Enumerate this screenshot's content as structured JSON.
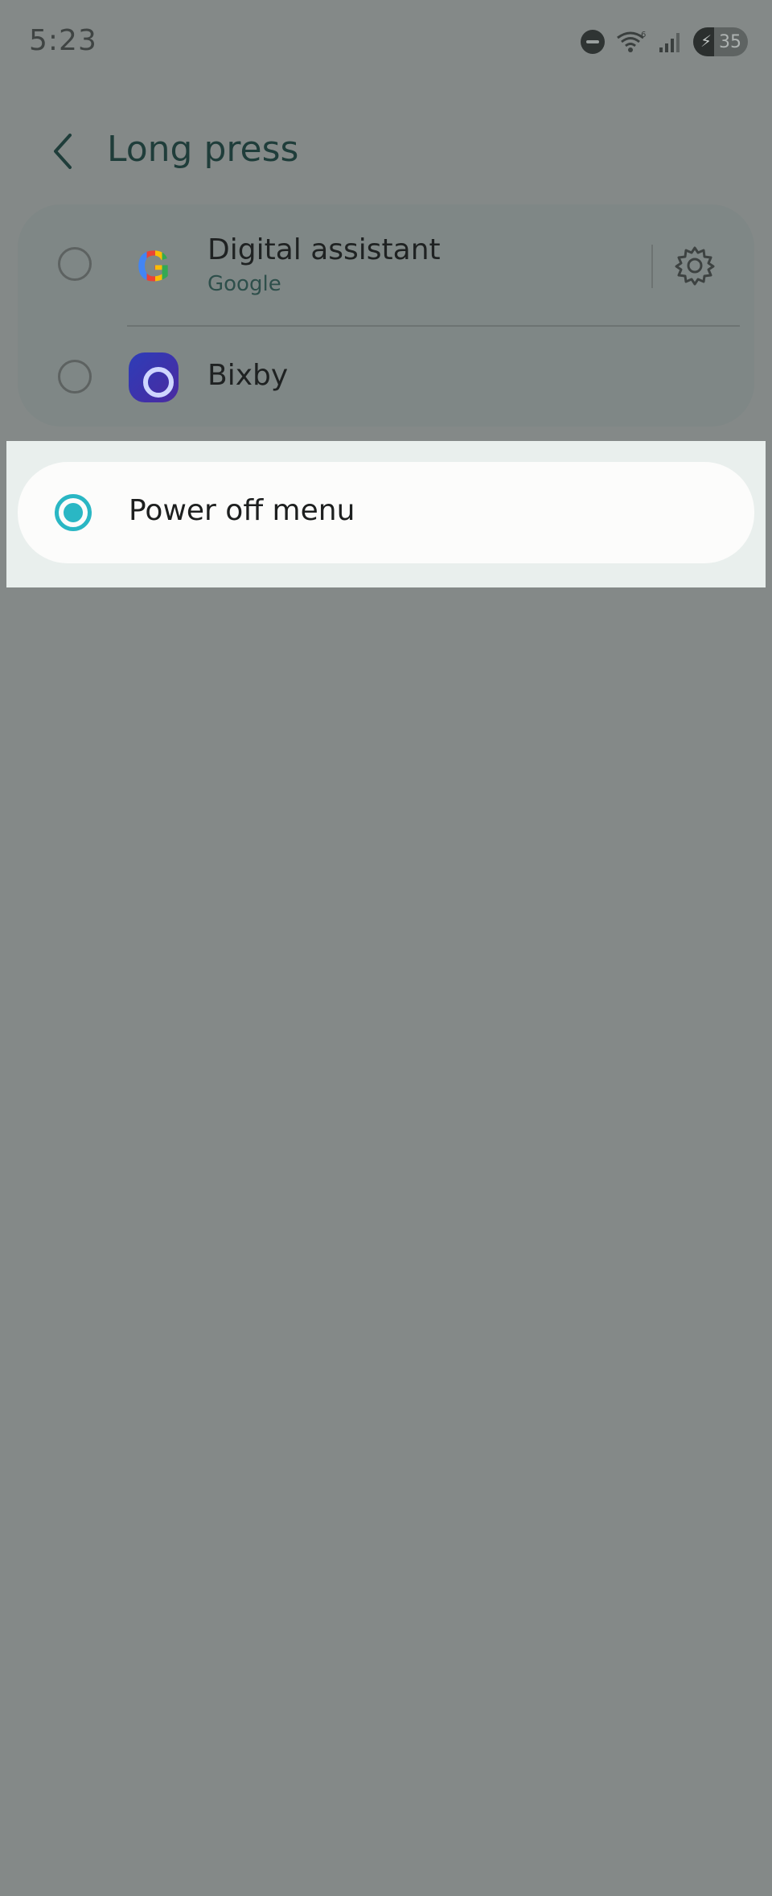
{
  "status_bar": {
    "time": "5:23",
    "battery_level": "35",
    "icons": [
      "do-not-disturb-icon",
      "wifi-6-icon",
      "signal-icon",
      "battery-charging-icon"
    ]
  },
  "header": {
    "title": "Long press",
    "back_icon": "chevron-left-icon"
  },
  "options": [
    {
      "title": "Digital assistant",
      "subtitle": "Google",
      "icon": "google-icon",
      "selected": false,
      "has_settings": true,
      "settings_icon": "gear-icon"
    },
    {
      "title": "Bixby",
      "icon": "bixby-icon",
      "selected": false
    },
    {
      "title": "Power off menu",
      "selected": true
    }
  ],
  "colors": {
    "accent": "#2ab7c4",
    "dim_background": "#848988",
    "title": "#1f3d3a"
  },
  "google_letter": "G"
}
